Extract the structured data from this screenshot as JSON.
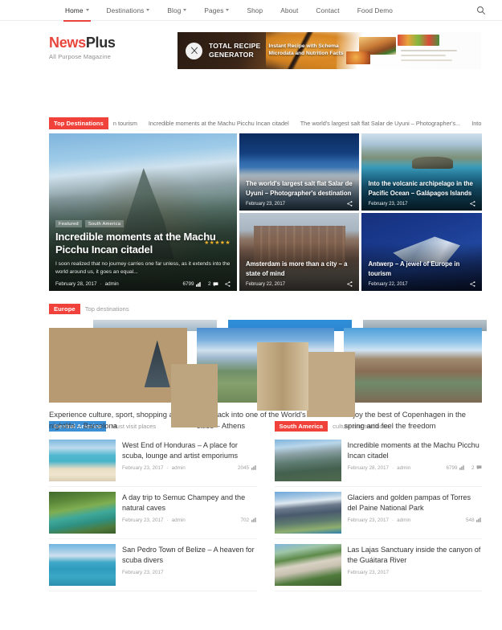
{
  "nav": {
    "items": [
      {
        "label": "Home",
        "caret": true,
        "active": true
      },
      {
        "label": "Destinations",
        "caret": true,
        "active": false
      },
      {
        "label": "Blog",
        "caret": true,
        "active": false
      },
      {
        "label": "Pages",
        "caret": true,
        "active": false
      },
      {
        "label": "Shop",
        "caret": false,
        "active": false
      },
      {
        "label": "About",
        "caret": false,
        "active": false
      },
      {
        "label": "Contact",
        "caret": false,
        "active": false
      },
      {
        "label": "Food Demo",
        "caret": false,
        "active": false
      }
    ],
    "search_icon": "search-icon"
  },
  "brand": {
    "name_part1": "News",
    "name_part2": "Plus",
    "tagline": "All Purpose Magazine",
    "color_accent": "#e8453c"
  },
  "banner": {
    "icon": "fork-knife-icon",
    "title_line1": "TOTAL RECIPE",
    "title_line2": "GENERATOR",
    "subtitle": "Instant Recipe with Schema Microdata and Nutrition Facts"
  },
  "ticker": {
    "label": "Top Destinations",
    "items": [
      "n tourism",
      "Incredible moments at the Machu Picchu Incan citadel",
      "The world's largest salt flat Salar de Uyuni – Photographer's...",
      "Into the volca"
    ]
  },
  "hero": {
    "main": {
      "badges": [
        "Featured",
        "South America"
      ],
      "title": "Incredible moments at the Machu Picchu Incan citadel",
      "excerpt": "I soon realized that no journey carries one far unless, as it extends into the world around us, it goes an equal...",
      "date": "February 28, 2017",
      "author": "admin",
      "views": "6799",
      "comments": "2",
      "stars": "★★★★★",
      "share_icon": "share-icon"
    },
    "side": [
      {
        "title": "The world's largest salt flat Salar de Uyuni – Photographer's destination",
        "date": "February 23, 2017",
        "share_icon": "share-icon"
      },
      {
        "title": "Into the volcanic archipelago in the Pacific Ocean – Galápagos Islands",
        "date": "February 23, 2017",
        "share_icon": "share-icon"
      },
      {
        "title": "Amsterdam is more than a city – a state of mind",
        "date": "February 22, 2017",
        "share_icon": "share-icon"
      },
      {
        "title": "Antwerp – A jewel of Europe in tourism",
        "date": "February 22, 2017",
        "share_icon": "share-icon"
      }
    ]
  },
  "europe": {
    "badge": "Europe",
    "badge_color": "#f0423a",
    "subtitle": "Top destinations",
    "cards": [
      {
        "title": "Experience culture, sport, shopping and nightlife – Barcelona"
      },
      {
        "title": "A rollback into one of the World's oldest cities – Athens"
      },
      {
        "title": "Enjoy the best of Copenhagen in the spring and feel the freedom"
      }
    ]
  },
  "central_america": {
    "badge": "Central America",
    "badge_color": "#3b8fd4",
    "subtitle": "Must visit places",
    "items": [
      {
        "title": "West End of Honduras – A place for scuba, lounge and artist emporiums",
        "date": "February 23, 2017",
        "author": "admin",
        "views": "2045",
        "comments": ""
      },
      {
        "title": "A day trip to Semuc Champey and the natural caves",
        "date": "February 23, 2017",
        "author": "admin",
        "views": "702",
        "comments": ""
      },
      {
        "title": "San Pedro Town of Belize – A heaven for scuba divers",
        "date": "February 23, 2017",
        "author": "admin",
        "views": "",
        "comments": ""
      }
    ]
  },
  "south_america": {
    "badge": "South America",
    "badge_color": "#f0423a",
    "subtitle": "culture and traditions",
    "items": [
      {
        "title": "Incredible moments at the Machu Picchu Incan citadel",
        "date": "February 28, 2017",
        "author": "admin",
        "views": "6799",
        "comments": "2"
      },
      {
        "title": "Glaciers and golden pampas of Torres del Paine National Park",
        "date": "February 23, 2017",
        "author": "admin",
        "views": "548",
        "comments": ""
      },
      {
        "title": "Las Lajas Sanctuary inside the canyon of the Guáitara River",
        "date": "February 23, 2017",
        "author": "admin",
        "views": "",
        "comments": ""
      }
    ]
  }
}
